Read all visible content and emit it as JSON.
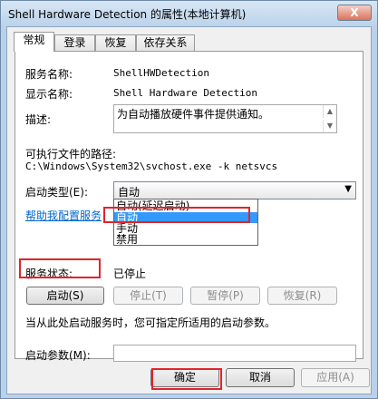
{
  "window": {
    "title": "Shell Hardware Detection 的属性(本地计算机)",
    "close_label": "X"
  },
  "tabs": [
    {
      "label": "常规",
      "active": true
    },
    {
      "label": "登录",
      "active": false
    },
    {
      "label": "恢复",
      "active": false
    },
    {
      "label": "依存关系",
      "active": false
    }
  ],
  "general": {
    "service_name_label": "服务名称:",
    "service_name_value": "ShellHWDetection",
    "display_name_label": "显示名称:",
    "display_name_value": "Shell Hardware Detection",
    "description_label": "描述:",
    "description_value": "为自动播放硬件事件提供通知。",
    "exe_path_label": "可执行文件的路径:",
    "exe_path_value": "C:\\Windows\\System32\\svchost.exe -k netsvcs",
    "startup_type_label": "启动类型(E):",
    "startup_type_value": "自动",
    "startup_options": [
      {
        "label": "自动(延迟启动)",
        "selected": false
      },
      {
        "label": "自动",
        "selected": true
      },
      {
        "label": "手动",
        "selected": false
      },
      {
        "label": "禁用",
        "selected": false
      }
    ],
    "help_link": "帮助我配置服务",
    "service_status_label": "服务状态:",
    "service_status_value": "已停止",
    "start_button": "启动(S)",
    "stop_button": "停止(T)",
    "pause_button": "暂停(P)",
    "resume_button": "恢复(R)",
    "hint_text": "当从此处启动服务时，您可指定所适用的启动参数。",
    "start_params_label": "启动参数(M):",
    "start_params_value": ""
  },
  "footer": {
    "ok_button": "确定",
    "cancel_button": "取消",
    "apply_button": "应用(A)"
  },
  "colors": {
    "highlight": "#e0242b",
    "selection": "#3399ff",
    "link": "#0066cc"
  }
}
